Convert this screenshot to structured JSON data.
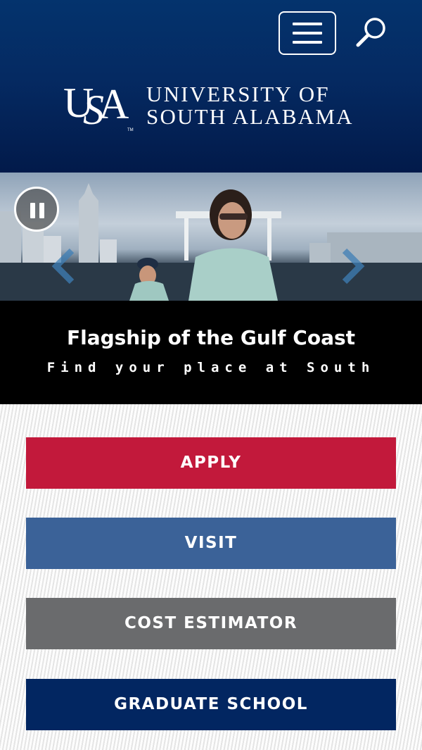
{
  "header": {
    "menu_label": "Menu",
    "search_label": "Search",
    "logo": {
      "mark": "USA",
      "line1": "UNIVERSITY OF",
      "line2": "SOUTH ALABAMA"
    }
  },
  "hero": {
    "title": "Flagship of the Gulf Coast",
    "subtitle": "Find your place at South",
    "pause_icon": "pause-icon",
    "prev_icon": "chevron-left-icon",
    "next_icon": "chevron-right-icon"
  },
  "cta": {
    "apply": "APPLY",
    "visit": "VISIT",
    "cost": "COST ESTIMATOR",
    "graduate": "GRADUATE SCHOOL"
  },
  "colors": {
    "header_navy": "#04336d",
    "apply_red": "#c2193b",
    "visit_blue": "#3b6298",
    "cost_gray": "#6a6b6d",
    "graduate_navy": "#022661"
  }
}
